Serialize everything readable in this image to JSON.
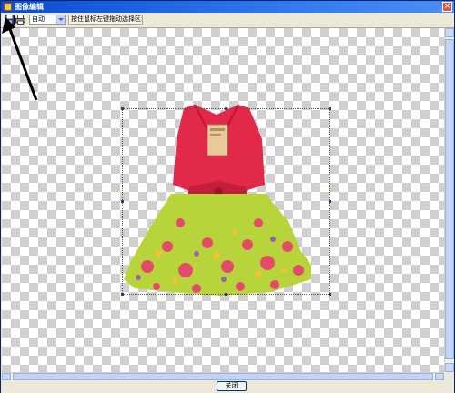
{
  "window": {
    "title": "图像编辑",
    "close_label": "×"
  },
  "toolbar": {
    "save_icon": "save-icon",
    "print_icon": "print-icon",
    "zoom_value": "自动",
    "hint_text": "按住鼠标左键拖动选择区域"
  },
  "footer": {
    "close_button_label": "关闭"
  },
  "colors": {
    "titlebar": "#0a4bd4",
    "dress_top": "#e2294a",
    "skirt_green": "#b7d43a"
  }
}
